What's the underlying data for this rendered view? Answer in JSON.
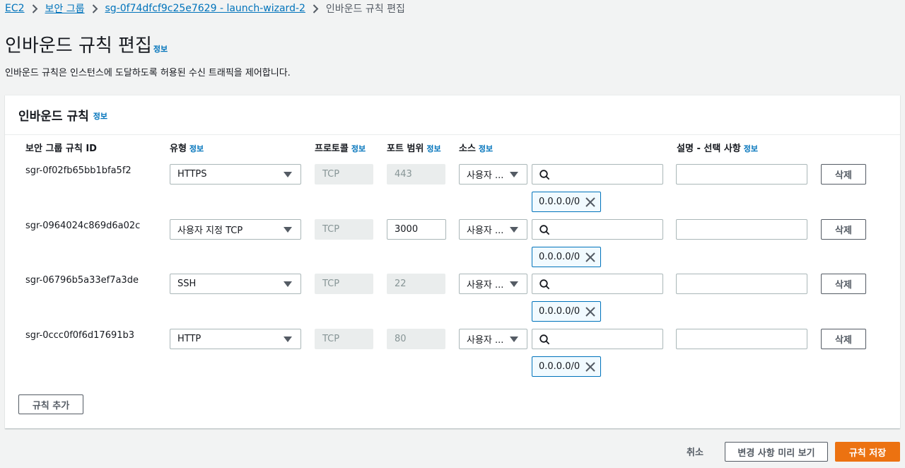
{
  "breadcrumb": {
    "items": [
      "EC2",
      "보안 그룹",
      "sg-0f74dfcf9c25e7629 - launch-wizard-2"
    ],
    "current": "인바운드 규칙 편집"
  },
  "page": {
    "title": "인바운드 규칙 편집",
    "info": "정보",
    "description": "인바운드 규칙은 인스턴스에 도달하도록 허용된 수신 트래픽을 제어합니다."
  },
  "panel": {
    "title": "인바운드 규칙",
    "info": "정보",
    "columns": {
      "rule_id": "보안 그룹 규칙 ID",
      "type": "유형",
      "protocol": "프로토콜",
      "port_range": "포트 범위",
      "source": "소스",
      "description": "설명 - 선택 사항"
    },
    "rules": [
      {
        "id": "sgr-0f02fb65bb1bfa5f2",
        "type": "HTTPS",
        "protocol": "TCP",
        "port": "443",
        "source_type": "사용자 ...",
        "search_value": "",
        "token": "0.0.0.0/0",
        "desc": "",
        "delete": "삭제"
      },
      {
        "id": "sgr-0964024c869d6a02c",
        "type": "사용자 지정 TCP",
        "protocol": "TCP",
        "port": "3000",
        "source_type": "사용자 ...",
        "search_value": "",
        "token": "0.0.0.0/0",
        "desc": "",
        "delete": "삭제"
      },
      {
        "id": "sgr-06796b5a33ef7a3de",
        "type": "SSH",
        "protocol": "TCP",
        "port": "22",
        "source_type": "사용자 ...",
        "search_value": "",
        "token": "0.0.0.0/0",
        "desc": "",
        "delete": "삭제"
      },
      {
        "id": "sgr-0ccc0f0f6d17691b3",
        "type": "HTTP",
        "protocol": "TCP",
        "port": "80",
        "source_type": "사용자 ...",
        "search_value": "",
        "token": "0.0.0.0/0",
        "desc": "",
        "delete": "삭제"
      }
    ],
    "add_rule": "규칙 추가"
  },
  "footer": {
    "cancel": "취소",
    "preview": "변경 사항 미리 보기",
    "save": "규칙 저장"
  },
  "colors": {
    "accent": "#ec7211",
    "link": "#0073bb",
    "background": "#f2f3f3"
  }
}
